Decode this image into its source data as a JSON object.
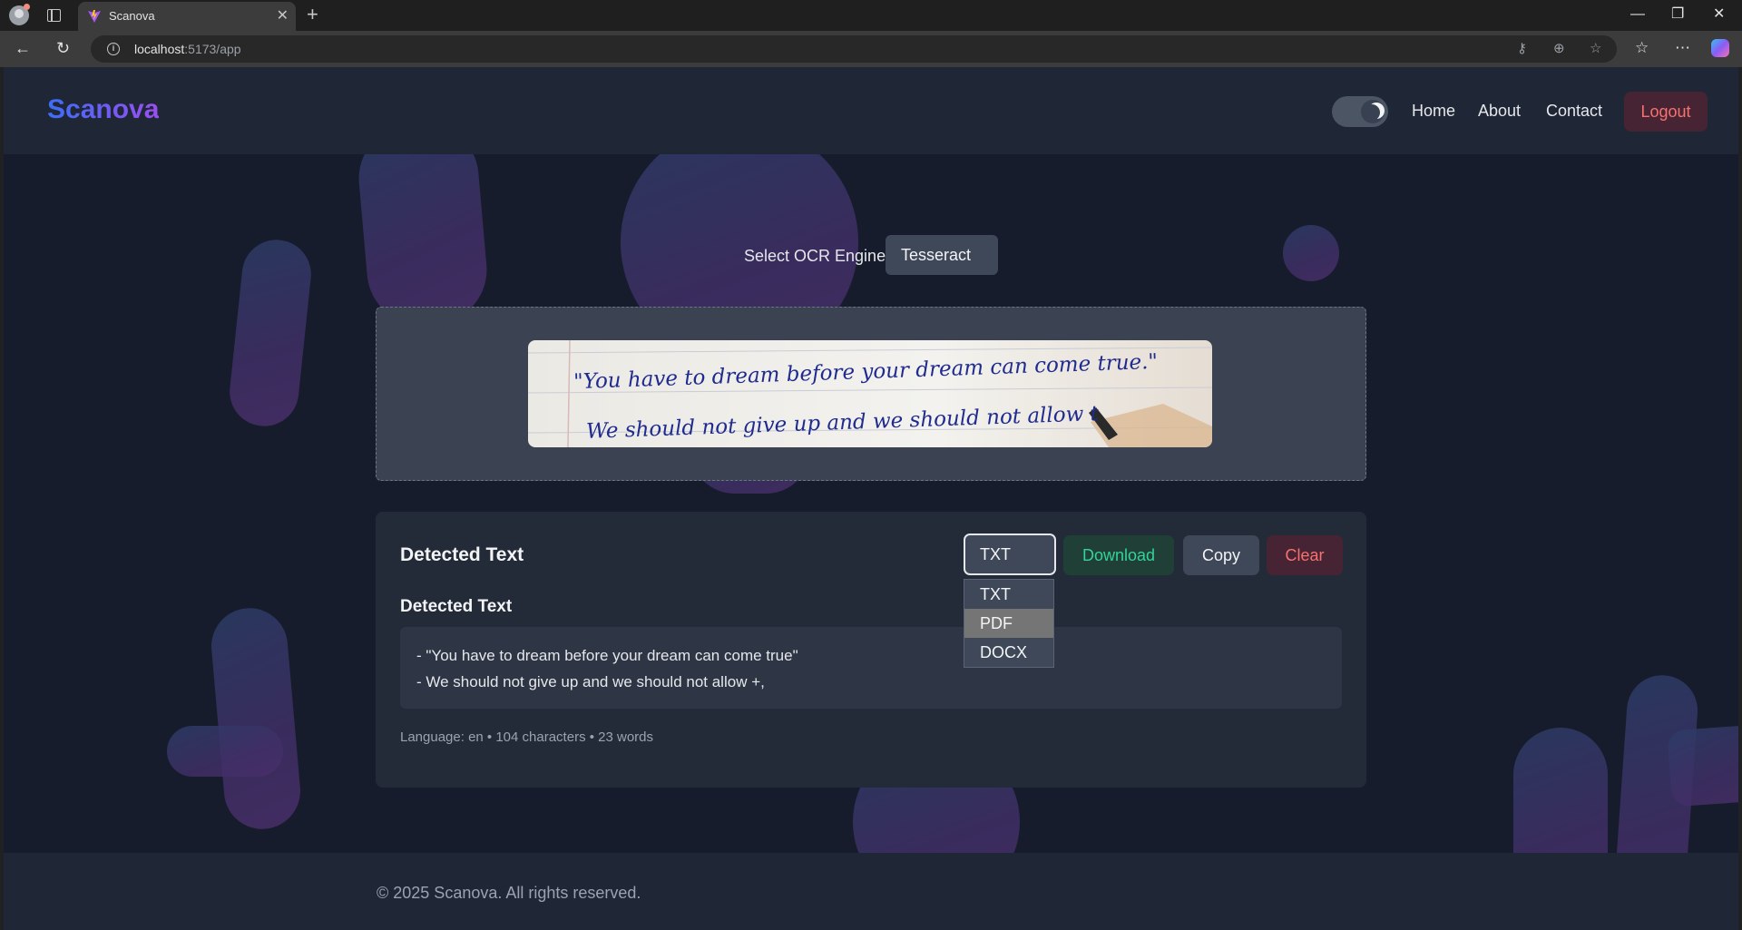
{
  "browser": {
    "tab_title": "Scanova",
    "url_host": "localhost",
    "url_rest": ":5173/app",
    "new_tab_label": "+",
    "tab_close_label": "✕",
    "minimize_label": "—",
    "restore_label": "❐",
    "close_label": "✕"
  },
  "navbar": {
    "logo": "Scanova",
    "links": {
      "home": "Home",
      "about": "About",
      "contact": "Contact"
    },
    "logout": "Logout",
    "theme": "dark"
  },
  "ocr": {
    "engine_label": "Select OCR Engine:",
    "engine_value": "Tesseract"
  },
  "upload": {
    "image_text": [
      "\"You have to dream before your dream can come true.\"",
      "We should not give up and we should not allow t"
    ]
  },
  "result": {
    "title": "Detected Text",
    "format_value": "TXT",
    "format_options": [
      "TXT",
      "PDF",
      "DOCX"
    ],
    "format_highlighted": "PDF",
    "download_label": "Download",
    "copy_label": "Copy",
    "clear_label": "Clear",
    "section_title": "Detected Text",
    "lines": [
      "- \"You have to dream before your dream can come true\"",
      "- We should not give up and we should not allow +,"
    ],
    "stats": "Language: en • 104 characters • 23 words"
  },
  "footer": {
    "text": "© 2025 Scanova. All rights reserved."
  },
  "colors": {
    "accent_start": "#3b6ef6",
    "accent_end": "#9b4ef0",
    "danger": "#f87171",
    "success": "#34d399",
    "page_bg": "#161c2b"
  }
}
